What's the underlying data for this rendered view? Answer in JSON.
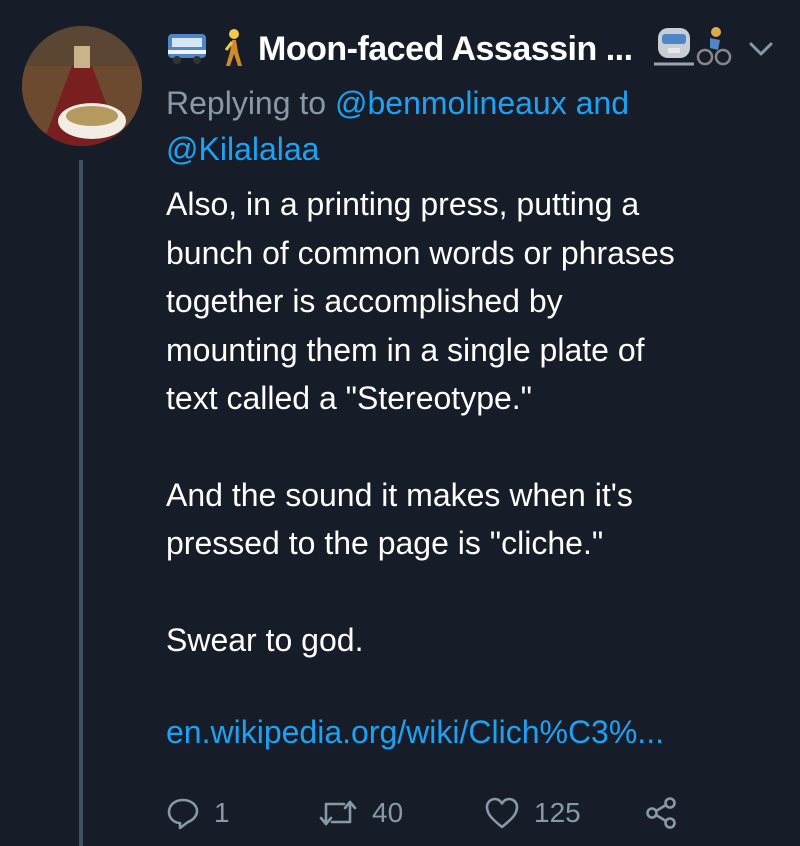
{
  "author": {
    "display_name": "Moon-faced Assassin ...",
    "name_prefix_icons": [
      "bus-emoji-icon",
      "person-walking-emoji-icon"
    ],
    "name_suffix_icons": [
      "train-emoji-icon",
      "person-cycling-emoji-icon"
    ]
  },
  "reply": {
    "prefix": "Replying to ",
    "mention_1": "@benmolineaux",
    "joiner": " and",
    "mention_2": "@Kilalalaa"
  },
  "body": {
    "line_1": "Also, in a printing press, putting a",
    "line_2": "bunch of common words or phrases",
    "line_3": "together is accomplished by",
    "line_4": "mounting them in a single plate of",
    "line_5": "text called a \"Stereotype.\"",
    "line_6": "And the sound it makes when it's",
    "line_7": "pressed to the page is \"cliche.\"",
    "line_8": "Swear to god."
  },
  "link": "en.wikipedia.org/wiki/Clich%C3%...",
  "actions": {
    "replies": "1",
    "retweets": "40",
    "likes": "125"
  },
  "colors": {
    "background": "#161d29",
    "text": "#ffffff",
    "secondary": "#8899a6",
    "accent": "#1da1f2"
  }
}
